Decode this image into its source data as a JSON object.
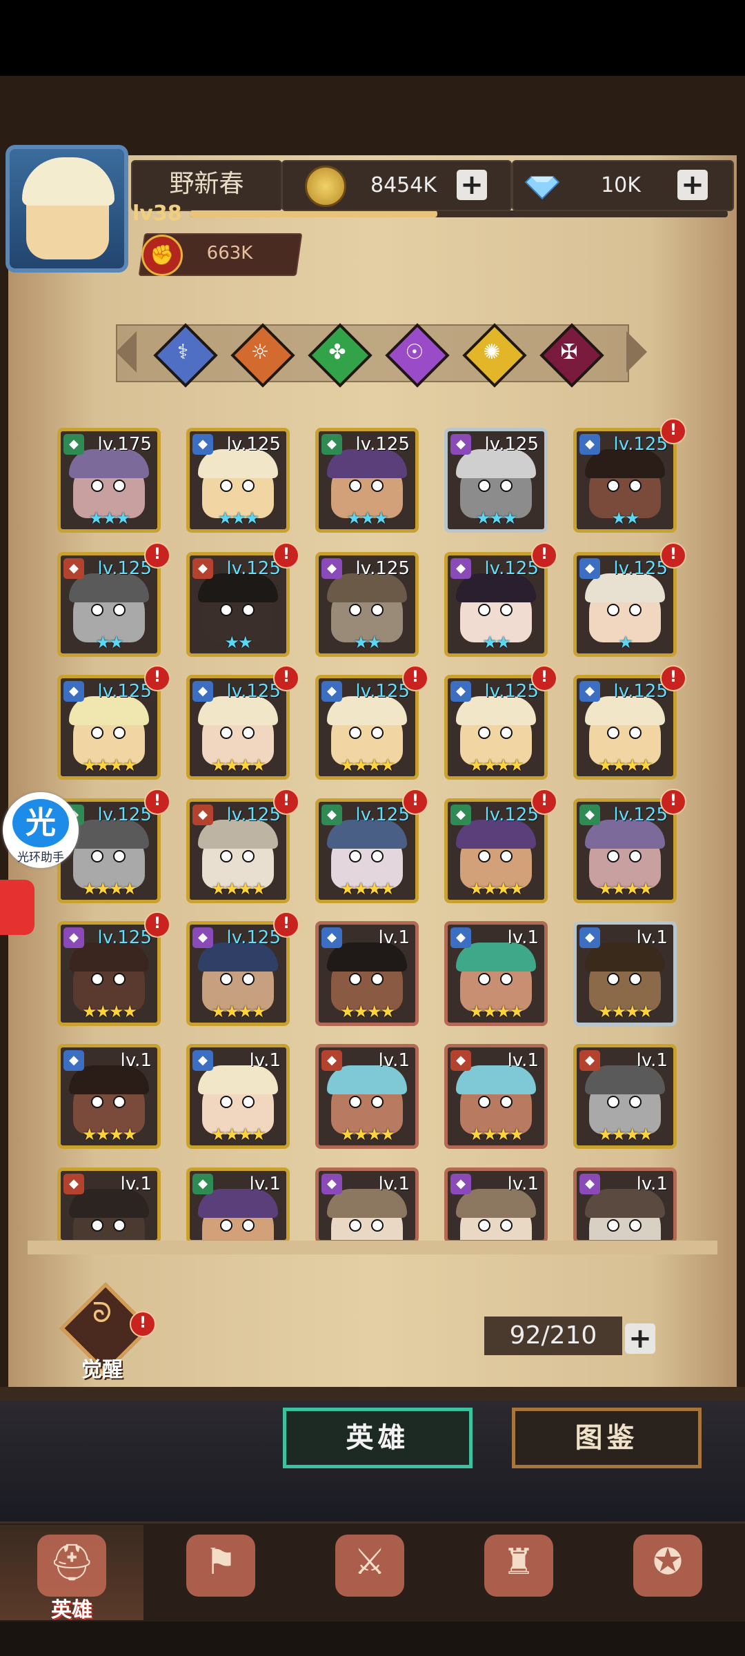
{
  "player": {
    "name": "野新春",
    "level": "lv38",
    "xp_fraction": 0.46,
    "gold": "8454K",
    "gems": "10K",
    "power": "663K"
  },
  "factions": [
    {
      "name": "faction-1",
      "color": "#4f6fc4",
      "symbol": "⚕"
    },
    {
      "name": "faction-2",
      "color": "#d36b2f",
      "symbol": "☼"
    },
    {
      "name": "faction-3",
      "color": "#33a34a",
      "symbol": "✤"
    },
    {
      "name": "faction-4",
      "color": "#9a4cc8",
      "symbol": "☉"
    },
    {
      "name": "faction-5",
      "color": "#e3b62a",
      "symbol": "✺"
    },
    {
      "name": "faction-6",
      "color": "#7a1a3c",
      "symbol": "✠"
    }
  ],
  "heroes": [
    {
      "lv": "lv.175",
      "tier": "gold",
      "stars": "★★★",
      "star_color": "cyan",
      "cls": "#2f8a54",
      "alert": false,
      "skin": "#c9a0a0",
      "hair": "#7b6a9a"
    },
    {
      "lv": "lv.125",
      "tier": "gold",
      "stars": "★★★",
      "star_color": "cyan",
      "cls": "#3c6fc1",
      "alert": false,
      "skin": "#f1d6a3",
      "hair": "#f1e6c7"
    },
    {
      "lv": "lv.125",
      "tier": "gold",
      "stars": "★★★",
      "star_color": "cyan",
      "cls": "#2f8a54",
      "alert": false,
      "skin": "#d2a17a",
      "hair": "#5b3f7a"
    },
    {
      "lv": "lv.125",
      "tier": "silver",
      "stars": "★★★",
      "star_color": "cyan",
      "cls": "#8a4ab8",
      "alert": false,
      "skin": "#8c8c8c",
      "hair": "#cfcfcf"
    },
    {
      "lv": "lv.125",
      "tier": "gold",
      "stars": "★★",
      "star_color": "cyan",
      "cls": "#3c6fc1",
      "alert": true,
      "skin": "#7a4a3a",
      "hair": "#2a1d18"
    },
    {
      "lv": "lv.125",
      "tier": "gold",
      "stars": "★★",
      "star_color": "cyan",
      "cls": "#b3432f",
      "alert": true,
      "skin": "#a9a9a9",
      "hair": "#5a5a5a"
    },
    {
      "lv": "lv.125",
      "tier": "gold",
      "stars": "★★",
      "star_color": "cyan",
      "cls": "#b3432f",
      "alert": true,
      "skin": "#3a2f2b",
      "hair": "#1d1916"
    },
    {
      "lv": "lv.125",
      "tier": "gold",
      "stars": "★★",
      "star_color": "cyan",
      "cls": "#8a4ab8",
      "alert": false,
      "skin": "#9a8a78",
      "hair": "#6b5a48"
    },
    {
      "lv": "lv.125",
      "tier": "gold",
      "stars": "★★",
      "star_color": "cyan",
      "cls": "#8a4ab8",
      "alert": true,
      "skin": "#f0dcd0",
      "hair": "#2a1f2f"
    },
    {
      "lv": "lv.125",
      "tier": "gold",
      "stars": "★",
      "star_color": "cyan",
      "cls": "#3c6fc1",
      "alert": true,
      "skin": "#f1d6c0",
      "hair": "#e8e0d0"
    },
    {
      "lv": "lv.125",
      "tier": "gold",
      "stars": "★★★★",
      "star_color": "gold",
      "cls": "#3c6fc1",
      "alert": true,
      "skin": "#f1d6a3",
      "hair": "#f0e6b0"
    },
    {
      "lv": "lv.125",
      "tier": "gold",
      "stars": "★★★★",
      "star_color": "gold",
      "cls": "#3c6fc1",
      "alert": true,
      "skin": "#f1d6c0",
      "hair": "#f1e6c7"
    },
    {
      "lv": "lv.125",
      "tier": "gold",
      "stars": "★★★★",
      "star_color": "gold",
      "cls": "#3c6fc1",
      "alert": true,
      "skin": "#f1d6a3",
      "hair": "#f1e6c7"
    },
    {
      "lv": "lv.125",
      "tier": "gold",
      "stars": "★★★★",
      "star_color": "gold",
      "cls": "#3c6fc1",
      "alert": true,
      "skin": "#f1d6a3",
      "hair": "#f1e6c7"
    },
    {
      "lv": "lv.125",
      "tier": "gold",
      "stars": "★★★★",
      "star_color": "gold",
      "cls": "#3c6fc1",
      "alert": true,
      "skin": "#f1d6a3",
      "hair": "#f1e6c7"
    },
    {
      "lv": "lv.125",
      "tier": "gold",
      "stars": "★★★★",
      "star_color": "gold",
      "cls": "#2f8a54",
      "alert": true,
      "skin": "#a9a9a9",
      "hair": "#5a5a5a"
    },
    {
      "lv": "lv.125",
      "tier": "gold",
      "stars": "★★★★",
      "star_color": "gold",
      "cls": "#b3432f",
      "alert": true,
      "skin": "#e8dfd0",
      "hair": "#bdb4a3"
    },
    {
      "lv": "lv.125",
      "tier": "gold",
      "stars": "★★★★",
      "star_color": "gold",
      "cls": "#2f8a54",
      "alert": true,
      "skin": "#e3d6dc",
      "hair": "#4a5f86"
    },
    {
      "lv": "lv.125",
      "tier": "gold",
      "stars": "★★★★",
      "star_color": "gold",
      "cls": "#2f8a54",
      "alert": true,
      "skin": "#d2a17a",
      "hair": "#5b3f7a"
    },
    {
      "lv": "lv.125",
      "tier": "gold",
      "stars": "★★★★",
      "star_color": "gold",
      "cls": "#2f8a54",
      "alert": true,
      "skin": "#c9a0a0",
      "hair": "#7b6a9a"
    },
    {
      "lv": "lv.125",
      "tier": "gold",
      "stars": "★★★★",
      "star_color": "gold",
      "cls": "#8a4ab8",
      "alert": true,
      "skin": "#5a3a2e",
      "hair": "#3a261e"
    },
    {
      "lv": "lv.125",
      "tier": "gold",
      "stars": "★★★★",
      "star_color": "gold",
      "cls": "#8a4ab8",
      "alert": true,
      "skin": "#c7a07f",
      "hair": "#2f3f66"
    },
    {
      "lv": "lv.1",
      "tier": "bronze",
      "stars": "★★★★",
      "star_color": "gold",
      "cls": "#3c6fc1",
      "alert": false,
      "skin": "#8a5a42",
      "hair": "#1f1a17"
    },
    {
      "lv": "lv.1",
      "tier": "bronze",
      "stars": "★★★★",
      "star_color": "gold",
      "cls": "#3c6fc1",
      "alert": false,
      "skin": "#c98f72",
      "hair": "#3ea889"
    },
    {
      "lv": "lv.1",
      "tier": "silver",
      "stars": "★★★★",
      "star_color": "gold",
      "cls": "#3c6fc1",
      "alert": false,
      "skin": "#8a6a48",
      "hair": "#3a2a1c"
    },
    {
      "lv": "lv.1",
      "tier": "gold",
      "stars": "★★★★",
      "star_color": "gold",
      "cls": "#3c6fc1",
      "alert": false,
      "skin": "#7a4a3a",
      "hair": "#2a1d18"
    },
    {
      "lv": "lv.1",
      "tier": "gold",
      "stars": "★★★★",
      "star_color": "gold",
      "cls": "#3c6fc1",
      "alert": false,
      "skin": "#f1d6c0",
      "hair": "#f1e6c7"
    },
    {
      "lv": "lv.1",
      "tier": "bronze",
      "stars": "★★★★",
      "star_color": "gold",
      "cls": "#b3432f",
      "alert": false,
      "skin": "#b87a60",
      "hair": "#7fc8d6"
    },
    {
      "lv": "lv.1",
      "tier": "bronze",
      "stars": "★★★★",
      "star_color": "gold",
      "cls": "#b3432f",
      "alert": false,
      "skin": "#b87a60",
      "hair": "#7fc8d6"
    },
    {
      "lv": "lv.1",
      "tier": "gold",
      "stars": "★★★★",
      "star_color": "gold",
      "cls": "#b3432f",
      "alert": false,
      "skin": "#a9a9a9",
      "hair": "#5a5a5a"
    },
    {
      "lv": "lv.1",
      "tier": "gold",
      "stars": "",
      "star_color": "gold",
      "cls": "#b3432f",
      "alert": false,
      "skin": "#4a3a30",
      "hair": "#2c2420"
    },
    {
      "lv": "lv.1",
      "tier": "gold",
      "stars": "",
      "star_color": "gold",
      "cls": "#2f8a54",
      "alert": false,
      "skin": "#d2a17a",
      "hair": "#5b3f7a"
    },
    {
      "lv": "lv.1",
      "tier": "bronze",
      "stars": "",
      "star_color": "gold",
      "cls": "#8a4ab8",
      "alert": false,
      "skin": "#e9d8c4",
      "hair": "#8c7860"
    },
    {
      "lv": "lv.1",
      "tier": "bronze",
      "stars": "",
      "star_color": "gold",
      "cls": "#8a4ab8",
      "alert": false,
      "skin": "#e9d8c4",
      "hair": "#8c7860"
    },
    {
      "lv": "lv.1",
      "tier": "bronze",
      "stars": "",
      "star_color": "gold",
      "cls": "#8a4ab8",
      "alert": false,
      "skin": "#d9d0c4",
      "hair": "#5a4a40"
    }
  ],
  "assistant": {
    "glyph": "光",
    "label": "光环助手"
  },
  "awaken": {
    "label": "觉醒",
    "icon": "awaken-icon"
  },
  "hero_count": "92/210",
  "tabs": {
    "hero": "英雄",
    "guide": "图鉴"
  },
  "nav": [
    {
      "icon": "helmet-icon",
      "label": "英雄",
      "active": true
    },
    {
      "icon": "flag-icon",
      "label": "",
      "active": false
    },
    {
      "icon": "crossed-swords-icon",
      "label": "",
      "active": false
    },
    {
      "icon": "castle-icon",
      "label": "",
      "active": false
    },
    {
      "icon": "guild-icon",
      "label": "",
      "active": false
    }
  ]
}
